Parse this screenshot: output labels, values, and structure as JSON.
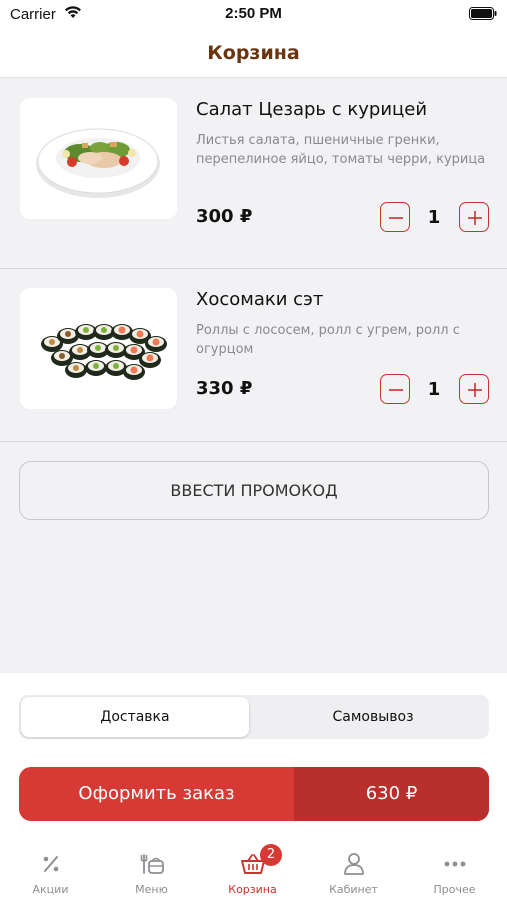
{
  "status_bar": {
    "carrier": "Carrier",
    "time": "2:50 PM"
  },
  "header": {
    "title": "Корзина"
  },
  "cart": {
    "items": [
      {
        "name": "Салат Цезарь с курицей",
        "description": "Листья салата, пшеничные гренки, перепелиное яйцо, томаты черри, курица",
        "price": "300 ₽",
        "quantity": "1",
        "image": "caesar-salad-image"
      },
      {
        "name": "Хосомаки сэт",
        "description": "Роллы с лососем, ролл с угрем, ролл с огурцом",
        "price": "330 ₽",
        "quantity": "1",
        "image": "hosomaki-set-image"
      }
    ],
    "promo_label": "ВВЕСТИ ПРОМОКОД"
  },
  "delivery": {
    "options": [
      "Доставка",
      "Самовывоз"
    ],
    "selected": "Доставка"
  },
  "order": {
    "label": "Оформить заказ",
    "total": "630 ₽"
  },
  "tab_bar": {
    "items": [
      {
        "label": "Акции",
        "icon": "percent-icon"
      },
      {
        "label": "Меню",
        "icon": "menu-dish-icon"
      },
      {
        "label": "Корзина",
        "icon": "basket-icon",
        "badge": "2"
      },
      {
        "label": "Кабинет",
        "icon": "user-icon"
      },
      {
        "label": "Прочее",
        "icon": "more-dots-icon"
      }
    ],
    "active": "Корзина"
  },
  "colors": {
    "accent": "#d73a34",
    "accent_dark": "#b8302b",
    "title": "#6b3410",
    "background": "#f2f2f4"
  }
}
